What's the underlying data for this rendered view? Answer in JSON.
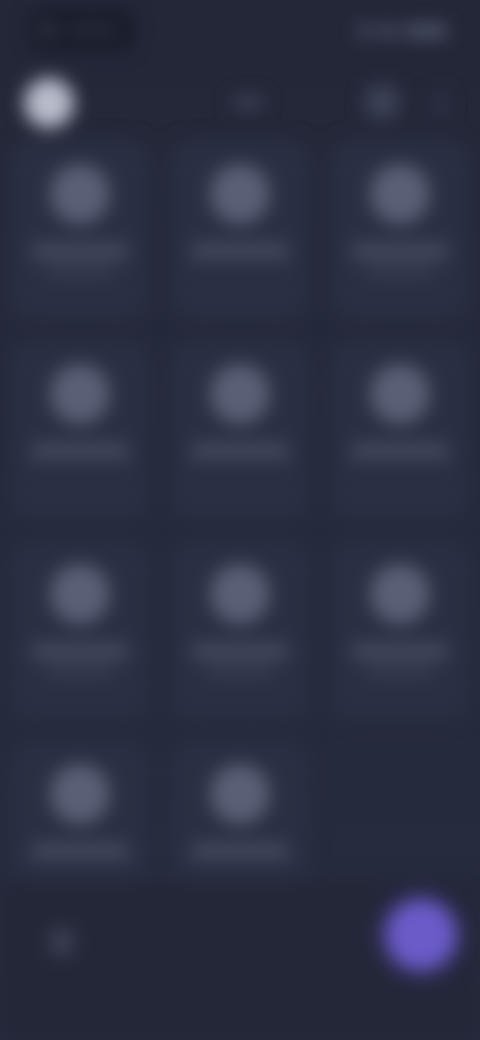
{
  "theme": {
    "background": "#22263a",
    "tile": "#2a2f43",
    "icon": "#5a5f76",
    "fab": "#6a5bc8",
    "avatar": "#b9bccb"
  },
  "status_bar": {
    "left_icon": "status-indicator-icon",
    "right_icons": [
      "signal-icon",
      "wifi-icon",
      "battery-icon"
    ]
  },
  "toolbar": {
    "avatar_icon": "profile-avatar-icon",
    "action_icon": "search-icon",
    "more_icon": "more-vertical-icon"
  },
  "grid": {
    "tiles": [
      {
        "icon": "app-icon"
      },
      {
        "icon": "app-icon"
      },
      {
        "icon": "app-icon"
      },
      {
        "icon": "app-icon"
      },
      {
        "icon": "app-icon"
      },
      {
        "icon": "app-icon"
      },
      {
        "icon": "app-icon"
      },
      {
        "icon": "app-icon"
      },
      {
        "icon": "app-icon"
      },
      {
        "icon": "app-icon"
      },
      {
        "icon": "app-icon"
      }
    ]
  },
  "bottom_bar": {
    "left_icon": "menu-icon",
    "fab_icon": "add-icon"
  }
}
